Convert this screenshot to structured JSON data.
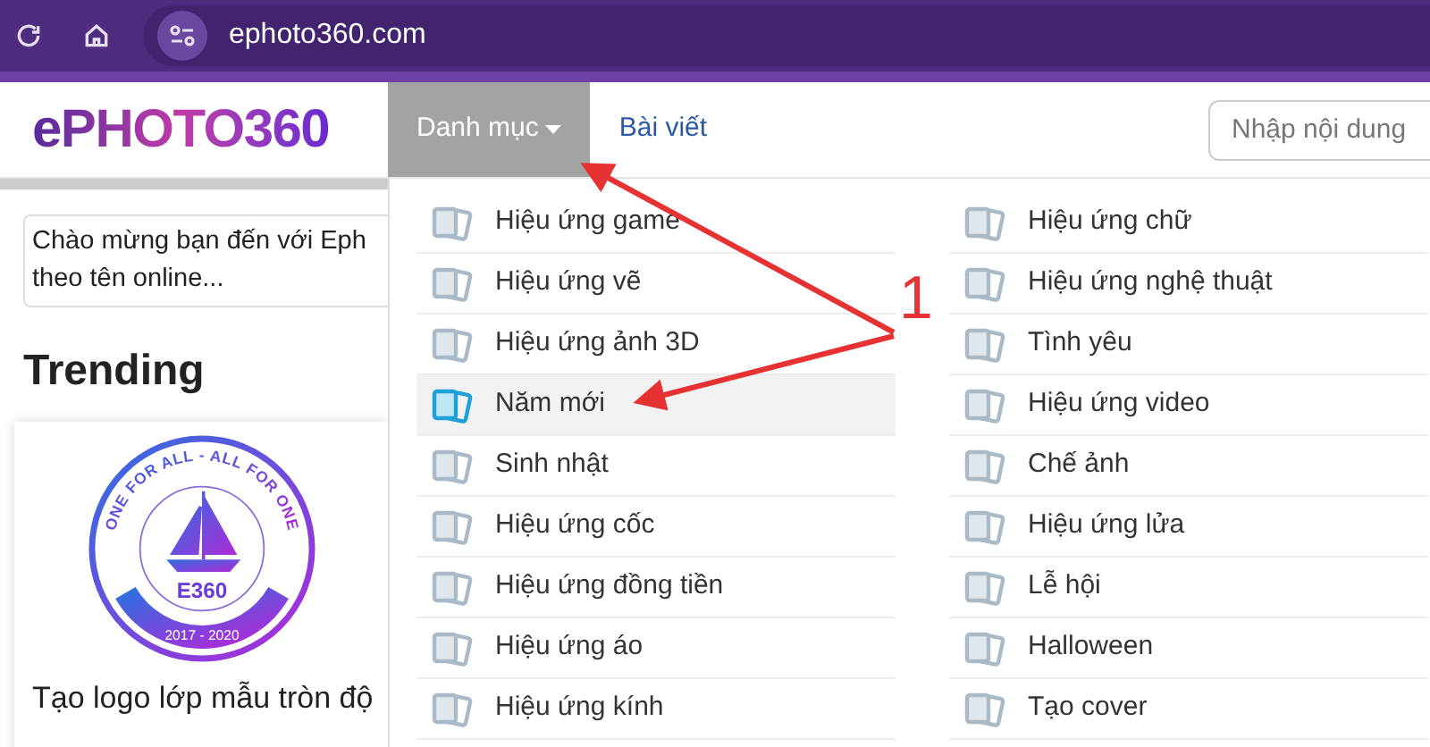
{
  "browser": {
    "url": "ephoto360.com"
  },
  "header": {
    "logo": "ePHOTO360",
    "nav": [
      {
        "label": "Danh mục",
        "selected": true,
        "dropdown": true
      },
      {
        "label": "Bài viết",
        "selected": false,
        "dropdown": false
      }
    ],
    "search": {
      "placeholder": "Nhập nội dung"
    }
  },
  "intro": {
    "lines": [
      "Chào mừng bạn đến với Eph",
      "theo tên online..."
    ]
  },
  "trending": {
    "title": "Trending",
    "card": {
      "badge": {
        "ring_text": "ONE FOR ALL - ALL FOR ONE",
        "name": "E360",
        "years": "2017 - 2020"
      },
      "caption": "Tạo logo lớp mẫu tròn độ"
    }
  },
  "menu": {
    "columns": [
      [
        {
          "label": "Hiệu ứng game",
          "selected": false
        },
        {
          "label": "Hiệu ứng vẽ",
          "selected": false
        },
        {
          "label": "Hiệu ứng ảnh 3D",
          "selected": false
        },
        {
          "label": "Năm mới",
          "selected": true
        },
        {
          "label": "Sinh nhật",
          "selected": false
        },
        {
          "label": "Hiệu ứng cốc",
          "selected": false
        },
        {
          "label": "Hiệu ứng đồng tiền",
          "selected": false
        },
        {
          "label": "Hiệu ứng áo",
          "selected": false
        },
        {
          "label": "Hiệu ứng kính",
          "selected": false
        }
      ],
      [
        {
          "label": "Hiệu ứng chữ",
          "selected": false
        },
        {
          "label": "Hiệu ứng nghệ thuật",
          "selected": false
        },
        {
          "label": "Tình yêu",
          "selected": false
        },
        {
          "label": "Hiệu ứng video",
          "selected": false
        },
        {
          "label": "Chế ảnh",
          "selected": false
        },
        {
          "label": "Hiệu ứng lửa",
          "selected": false
        },
        {
          "label": "Lễ hội",
          "selected": false
        },
        {
          "label": "Halloween",
          "selected": false
        },
        {
          "label": "Tạo cover",
          "selected": false
        }
      ]
    ]
  },
  "annotation": {
    "label": "1"
  }
}
